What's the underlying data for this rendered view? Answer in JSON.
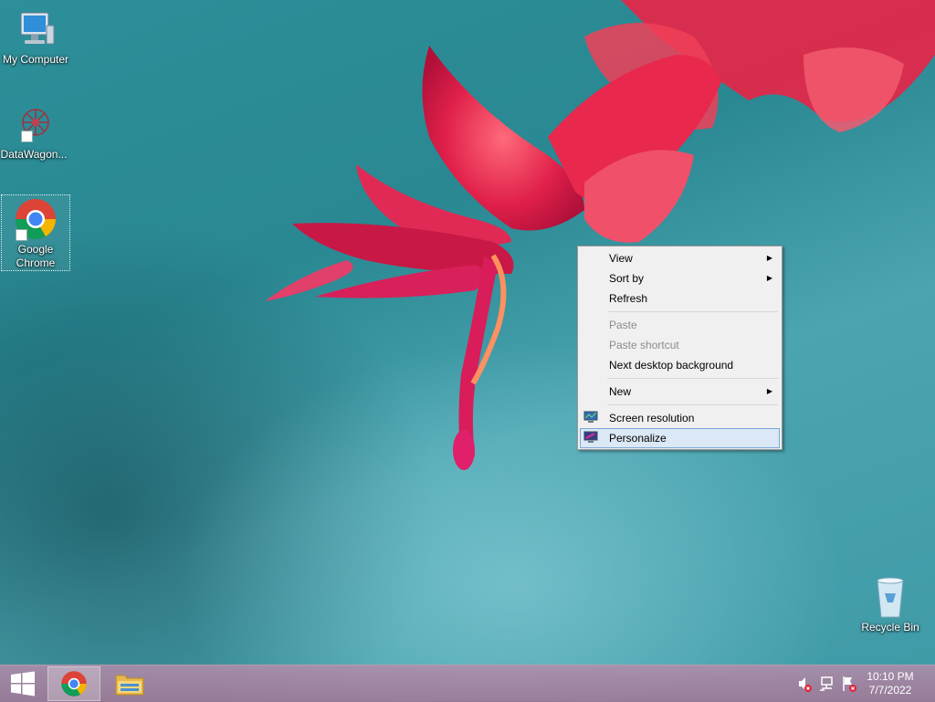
{
  "desktop": {
    "icons": [
      {
        "label": "My Computer"
      },
      {
        "label": "DataWagon..."
      },
      {
        "label": "Google Chrome"
      },
      {
        "label": "Recycle Bin"
      }
    ]
  },
  "context_menu": {
    "items": [
      {
        "label": "View",
        "submenu": true
      },
      {
        "label": "Sort by",
        "submenu": true
      },
      {
        "label": "Refresh"
      },
      {
        "label": "Paste",
        "disabled": true
      },
      {
        "label": "Paste shortcut",
        "disabled": true
      },
      {
        "label": "Next desktop background"
      },
      {
        "label": "New",
        "submenu": true
      },
      {
        "label": "Screen resolution",
        "icon": "monitor-icon"
      },
      {
        "label": "Personalize",
        "icon": "personalize-icon",
        "highlighted": true
      }
    ]
  },
  "taskbar": {
    "start_icon": "windows-logo-icon",
    "pinned": [
      {
        "name": "Google Chrome",
        "icon": "chrome-icon",
        "active": true
      },
      {
        "name": "File Explorer",
        "icon": "folder-icon",
        "active": false
      }
    ],
    "tray_icons": [
      "speaker-muted-icon",
      "network-icon",
      "action-center-flag-icon"
    ],
    "clock": {
      "time": "10:10 PM",
      "date": "7/7/2022"
    }
  }
}
